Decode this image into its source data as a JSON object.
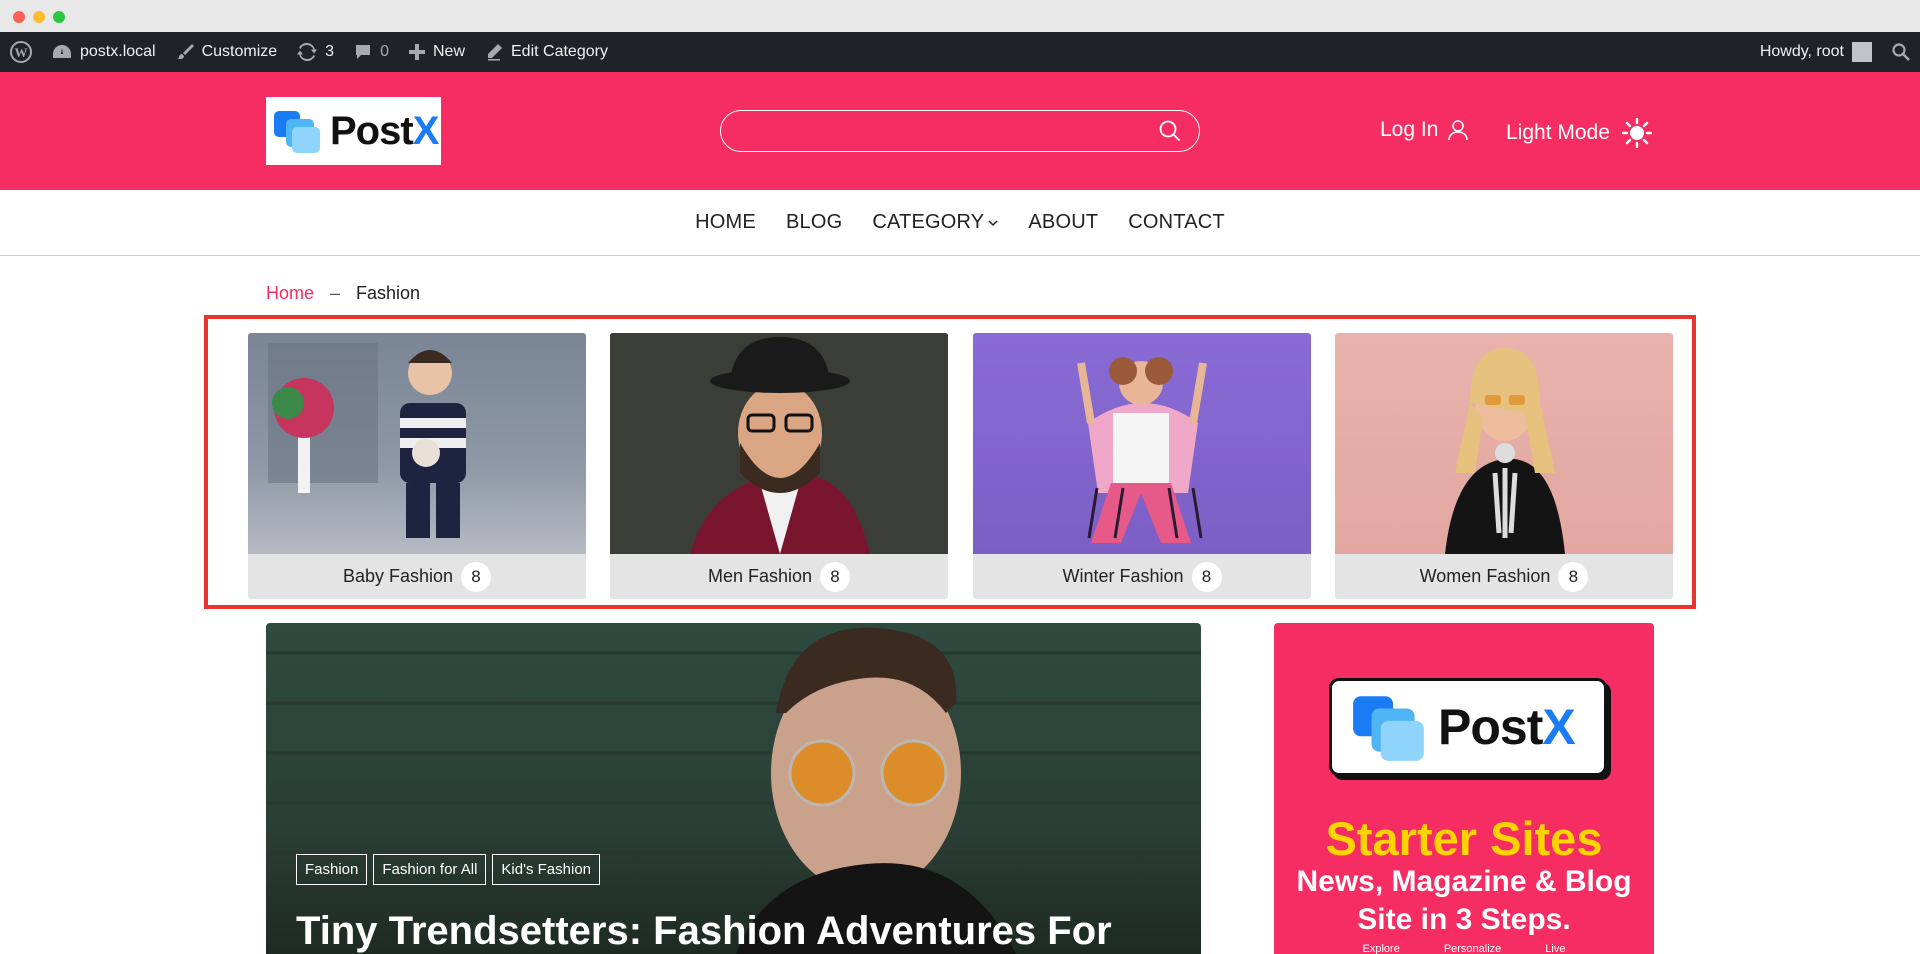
{
  "adminbar": {
    "site": "postx.local",
    "customize": "Customize",
    "updates": "3",
    "comments": "0",
    "new": "New",
    "edit": "Edit Category",
    "howdy": "Howdy, root"
  },
  "header": {
    "logo_text": "Post",
    "logo_accent": "X",
    "login": "Log In",
    "light_mode": "Light Mode"
  },
  "nav": [
    "HOME",
    "BLOG",
    "CATEGORY",
    "ABOUT",
    "CONTACT"
  ],
  "breadcrumb": {
    "home": "Home",
    "sep": "–",
    "current": "Fashion"
  },
  "categories": [
    {
      "name": "Baby Fashion",
      "count": "8"
    },
    {
      "name": "Men Fashion",
      "count": "8"
    },
    {
      "name": "Winter Fashion",
      "count": "8"
    },
    {
      "name": "Women Fashion",
      "count": "8"
    }
  ],
  "feature": {
    "tags": [
      "Fashion",
      "Fashion for All",
      "Kid's Fashion"
    ],
    "title": "Tiny Trendsetters: Fashion Adventures For"
  },
  "ad": {
    "logo_text": "Post",
    "logo_accent": "X",
    "headline": "Starter Sites",
    "sub1": "News, Magazine & Blog",
    "sub2": "Site in 3 Steps.",
    "steps": [
      "Explore",
      "Personalize",
      "Live"
    ]
  },
  "colors": {
    "brand": "#f52d63",
    "accent": "#1a7cf5",
    "highlight": "#e8362e",
    "ad_headline": "#ffd400"
  }
}
